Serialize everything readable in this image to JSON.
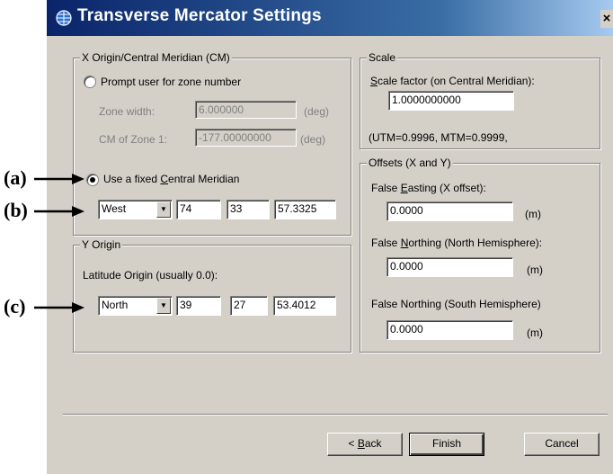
{
  "window": {
    "title": "Transverse Mercator Settings",
    "close_label": "×"
  },
  "annotations": [
    "(a)",
    "(b)",
    "(c)"
  ],
  "x_origin": {
    "group_label": "X Origin/Central Meridian (CM)",
    "prompt_option": "Prompt user for zone number",
    "zone_width_label": "Zone width:",
    "zone_width_value": "6.000000",
    "zone_width_unit": "(deg)",
    "cm_zone1_label": "CM of Zone 1:",
    "cm_zone1_value": "-177.00000000",
    "cm_zone1_unit": "(deg)",
    "fixed_option_pre": "Use a fixed ",
    "fixed_option_hot": "C",
    "fixed_option_post": "entral Meridian",
    "selected_option": "fixed",
    "hemisphere": "West",
    "deg": "74",
    "min": "33",
    "sec": "57.3325"
  },
  "y_origin": {
    "group_label": "Y Origin",
    "latitude_label": "Latitude Origin (usually 0.0):",
    "hemisphere": "North",
    "deg": "39",
    "min": "27",
    "sec": "53.4012"
  },
  "scale": {
    "group_label": "Scale",
    "factor_label_hot": "S",
    "factor_label_rest": "cale factor (on Central Meridian):",
    "factor_value": "1.0000000000",
    "note": "(UTM=0.9996, MTM=0.9999,"
  },
  "offsets": {
    "group_label": "Offsets (X and Y)",
    "easting_pre": "False ",
    "easting_hot": "E",
    "easting_post": "asting (X offset):",
    "easting_value": "0.0000",
    "easting_unit": "(m)",
    "north_pre": "False ",
    "north_hot": "N",
    "north_post": "orthing (North Hemisphere):",
    "north_value": "0.0000",
    "north_unit": "(m)",
    "south_label": "False Northing (South Hemisphere)",
    "south_value": "0.0000",
    "south_unit": "(m)"
  },
  "buttons": {
    "back_prefix": "< ",
    "back_hot": "B",
    "back_rest": "ack",
    "finish": "Finish",
    "cancel": "Cancel"
  },
  "icons": {
    "title_icon": "globe-icon",
    "dropdown_icon": "triangle-down"
  }
}
